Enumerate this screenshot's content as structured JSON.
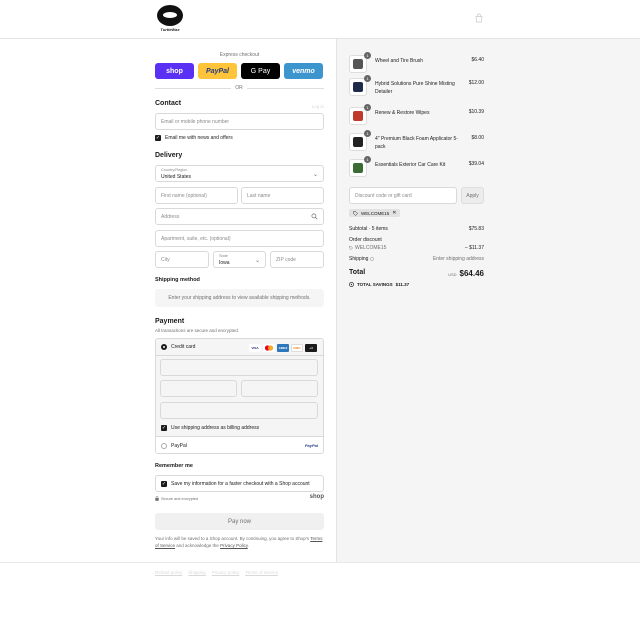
{
  "header": {
    "logo_text": "TurtleWax"
  },
  "express": {
    "title": "Express checkout",
    "buttons": [
      "shop",
      "PayPal",
      "G Pay",
      "venmo"
    ],
    "or": "OR"
  },
  "contact": {
    "heading": "Contact",
    "login": "Log in",
    "email_placeholder": "Email or mobile phone number",
    "news_label": "Email me with news and offers"
  },
  "delivery": {
    "heading": "Delivery",
    "country_label": "Country/Region",
    "country_value": "United States",
    "first_name": "First name (optional)",
    "last_name": "Last name",
    "address": "Address",
    "apartment": "Apartment, suite, etc. (optional)",
    "city": "City",
    "state_label": "State",
    "state_value": "Iowa",
    "zip": "ZIP code"
  },
  "shipping": {
    "heading": "Shipping method",
    "notice": "Enter your shipping address to view available shipping methods."
  },
  "payment": {
    "heading": "Payment",
    "subtitle": "All transactions are secure and encrypted.",
    "credit_card": "Credit card",
    "card_logos": [
      "VISA",
      "MC",
      "AMEX",
      "DISC",
      "+4"
    ],
    "billing_label": "Use shipping address as billing address",
    "paypal": "PayPal",
    "paypal_logo": "PayPal"
  },
  "remember": {
    "heading": "Remember me",
    "save_label": "Save my information for a faster checkout with a Shop account",
    "secure": "Secure and encrypted",
    "shop": "shop"
  },
  "pay_now": "Pay now",
  "terms": {
    "before": "Your info will be saved to a Shop account. By continuing, you agree to Shop's ",
    "tos": "Terms of Service",
    "middle": " and acknowledge the ",
    "privacy": "Privacy Policy",
    "after": "."
  },
  "footer": [
    "Refund policy",
    "Shipping",
    "Privacy policy",
    "Terms of service"
  ],
  "cart": {
    "items": [
      {
        "qty": "1",
        "name": "Wheel and Tire Brush",
        "price": "$6.40",
        "color": "#555555"
      },
      {
        "qty": "1",
        "name": "Hybrid Solutions Pure Shine Misting Detailer",
        "price": "$12.00",
        "color": "#1e2a4a"
      },
      {
        "qty": "1",
        "name": "Renew & Restore Wipes",
        "price": "$10.39",
        "color": "#c0392b"
      },
      {
        "qty": "1",
        "name": "4\" Premium Black Foam Applicator 5-pack",
        "price": "$8.00",
        "color": "#222222"
      },
      {
        "qty": "1",
        "name": "Essentials Exterior Car Care Kit",
        "price": "$39.04",
        "color": "#3a6b35"
      }
    ],
    "discount_placeholder": "Discount code or gift card",
    "apply": "Apply",
    "tag": "WELCOME15"
  },
  "summary": {
    "subtotal_label": "Subtotal · 5 items",
    "subtotal": "$75.83",
    "order_discount": "Order discount",
    "code": "WELCOME15",
    "discount": "– $11.37",
    "shipping_label": "Shipping",
    "shipping_value": "Enter shipping address",
    "total_label": "Total",
    "currency": "USD",
    "total": "$64.46",
    "savings_label": "TOTAL SAVINGS",
    "savings": "$11.37"
  }
}
